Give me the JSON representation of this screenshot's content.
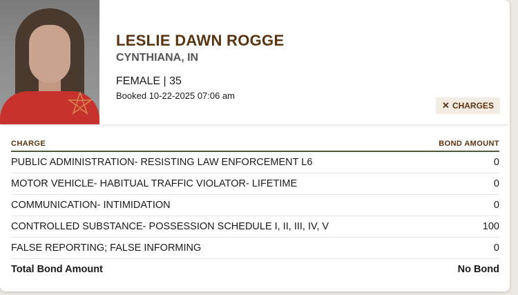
{
  "inmate": {
    "name": "LESLIE DAWN ROGGE",
    "location": "CYNTHIANA, IN",
    "sex_age": "FEMALE | 35",
    "booked": "Booked 10-22-2025 07:06 am"
  },
  "charges_button": {
    "icon": "close-icon",
    "label": "CHARGES"
  },
  "table": {
    "columns": [
      "CHARGE",
      "BOND AMOUNT"
    ],
    "rows": [
      {
        "charge": "PUBLIC ADMINISTRATION- RESISTING LAW ENFORCEMENT L6",
        "bond": "0"
      },
      {
        "charge": "MOTOR VEHICLE- HABITUAL TRAFFIC VIOLATOR- LIFETIME",
        "bond": "0"
      },
      {
        "charge": "COMMUNICATION- INTIMIDATION",
        "bond": "0"
      },
      {
        "charge": "CONTROLLED SUBSTANCE- POSSESSION SCHEDULE I, II, III, IV, V",
        "bond": "100"
      },
      {
        "charge": "FALSE REPORTING; FALSE INFORMING",
        "bond": "0"
      }
    ],
    "total": {
      "label": "Total Bond Amount",
      "value": "No Bond"
    }
  },
  "colors": {
    "accent": "#5a3410",
    "rule": "#4d5a3d",
    "button_bg": "#f3ece3"
  }
}
